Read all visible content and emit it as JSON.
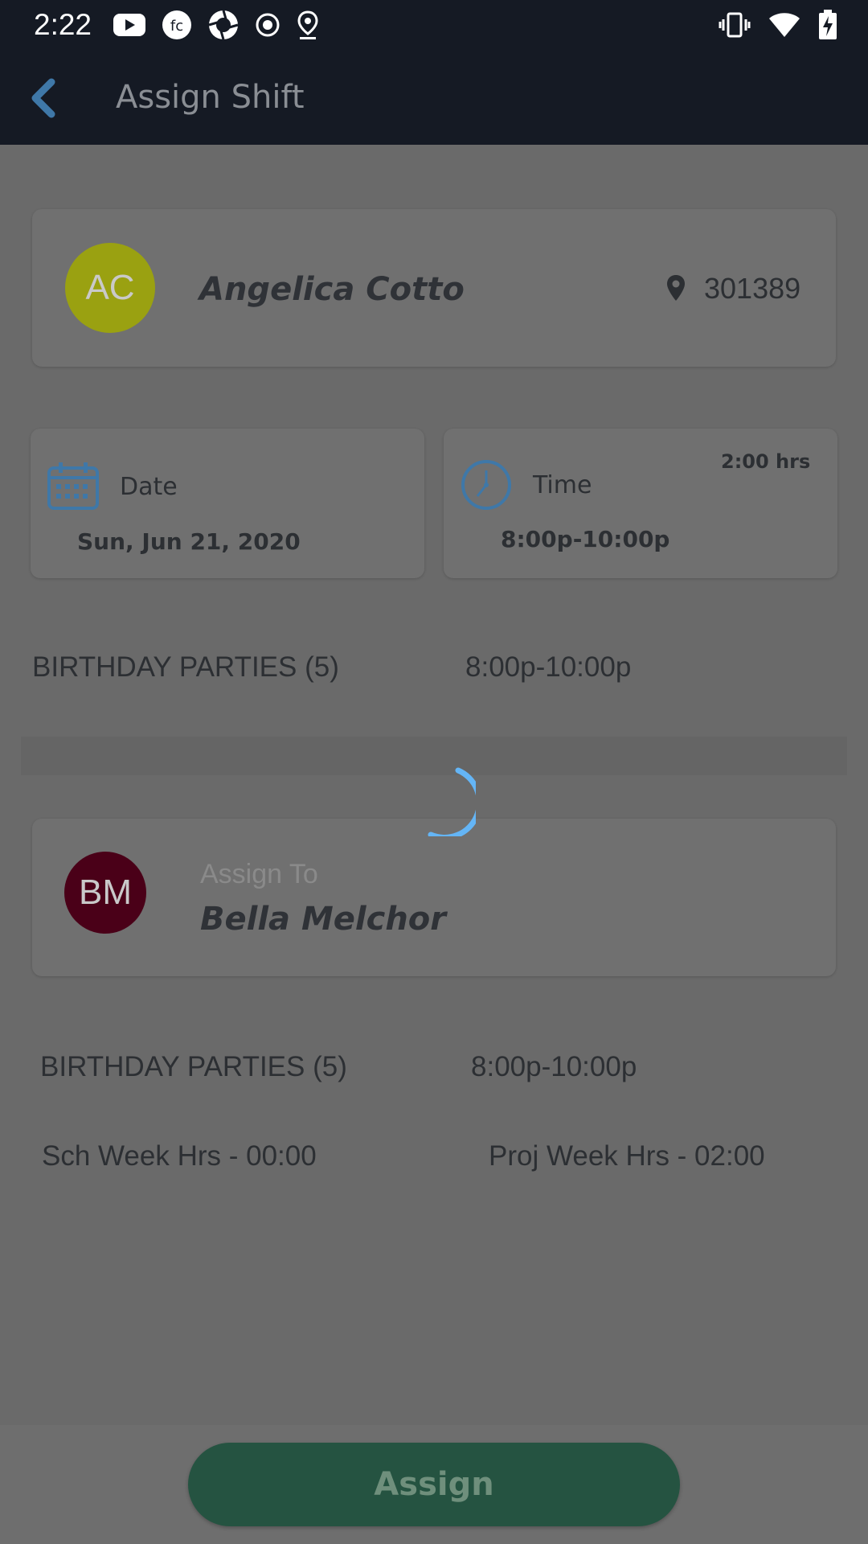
{
  "status_bar": {
    "time": "2:22"
  },
  "app_bar": {
    "title": "Assign Shift"
  },
  "employee": {
    "initials": "AC",
    "name": "Angelica Cotto",
    "location_code": "301389",
    "avatar_color": "#9aa111"
  },
  "date_card": {
    "label": "Date",
    "value": "Sun, Jun 21, 2020"
  },
  "time_card": {
    "label": "Time",
    "value": "8:00p-10:00p",
    "duration": "2:00 hrs"
  },
  "shift_row": {
    "position": "BIRTHDAY PARTIES (5)",
    "time": "8:00p-10:00p"
  },
  "assignee": {
    "initials": "BM",
    "label": "Assign To",
    "name": "Bella Melchor",
    "avatar_color": "#4a0018"
  },
  "assignee_details": {
    "position": "BIRTHDAY PARTIES (5)",
    "time": "8:00p-10:00p",
    "sch_week_hrs": "Sch Week Hrs - 00:00",
    "proj_week_hrs": "Proj Week Hrs - 02:00"
  },
  "action": {
    "assign_label": "Assign"
  },
  "colors": {
    "accent_blue": "#3f78a8",
    "button_green": "#255341",
    "spinner_blue": "#64b5f6"
  }
}
